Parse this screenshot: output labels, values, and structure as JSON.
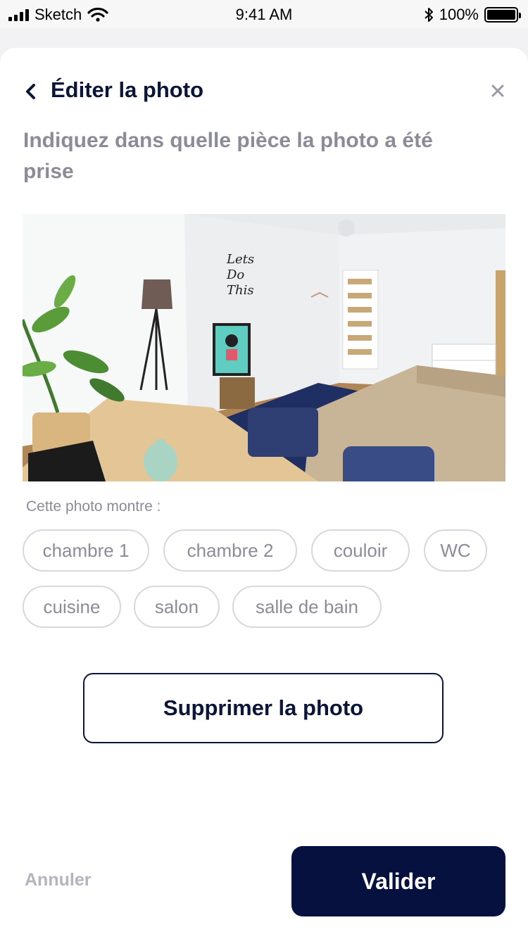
{
  "status_bar": {
    "carrier": "Sketch",
    "time": "9:41 AM",
    "battery": "100%",
    "icons": [
      "signal-icon",
      "wifi-icon",
      "bluetooth-icon",
      "battery-icon"
    ]
  },
  "header": {
    "title": "Éditer la photo",
    "back_icon": "chevron-left-icon",
    "close_icon": "close-icon"
  },
  "subtitle": "Indiquez dans quelle pièce la photo a été prise",
  "photo": {},
  "room_picker": {
    "label": "Cette photo montre :",
    "options": [
      "chambre 1",
      "chambre 2",
      "couloir",
      "WC",
      "cuisine",
      "salon",
      "salle de bain"
    ]
  },
  "actions": {
    "delete_label": "Supprimer la photo",
    "cancel_label": "Annuler",
    "validate_label": "Valider"
  },
  "colors": {
    "primary": "#061140",
    "muted": "#8b8c98",
    "chip_border": "#d7d8de"
  }
}
